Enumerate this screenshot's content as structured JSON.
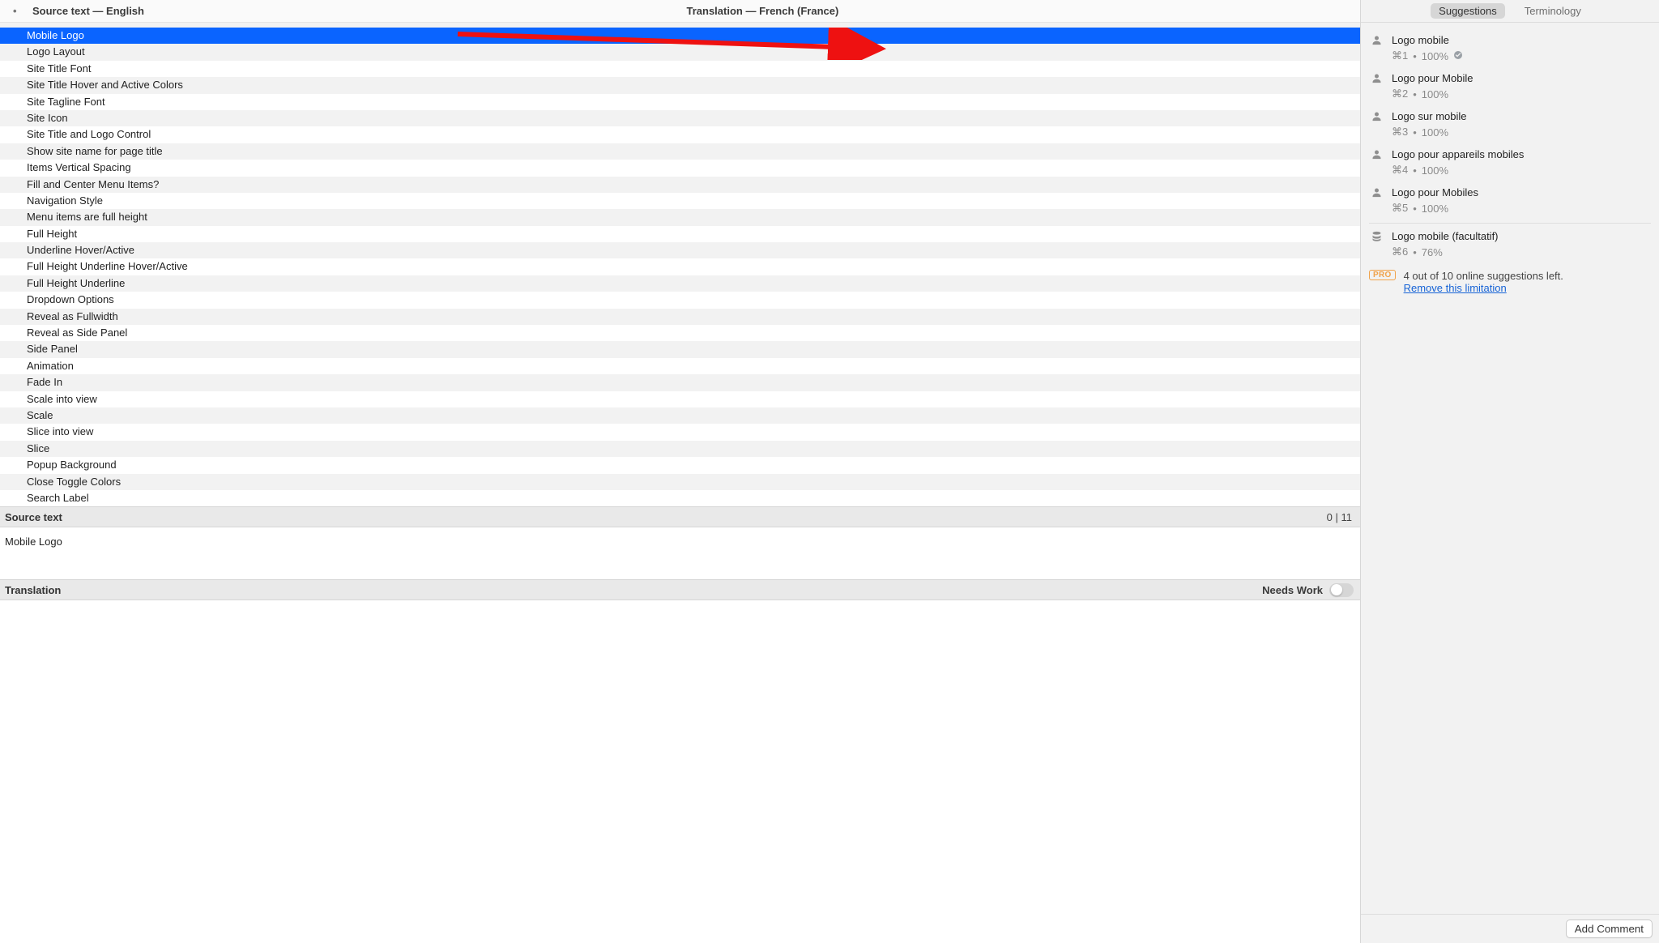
{
  "header": {
    "source_col": "Source text — English",
    "target_col": "Translation — French (France)"
  },
  "list": {
    "partial_top": "",
    "items": [
      "Mobile Logo",
      "Logo Layout",
      "Site Title Font",
      "Site Title Hover and Active Colors",
      "Site Tagline Font",
      "Site Icon",
      "Site Title and Logo Control",
      "Show site name for page title",
      "Items Vertical Spacing",
      "Fill and Center Menu Items?",
      "Navigation Style",
      "Menu items are full height",
      "Full Height",
      "Underline Hover/Active",
      "Full Height Underline Hover/Active",
      "Full Height Underline",
      "Dropdown Options",
      "Reveal as Fullwidth",
      "Reveal as Side Panel",
      "Side Panel",
      "Animation",
      "Fade In",
      "Scale into view",
      "Scale",
      "Slice into view",
      "Slice",
      "Popup Background",
      "Close Toggle Colors",
      "Search Label"
    ],
    "selected_index": 0
  },
  "source_pane": {
    "label": "Source text",
    "counts": "0 | 11",
    "value": "Mobile Logo"
  },
  "translation_pane": {
    "label": "Translation",
    "needs_work_label": "Needs Work",
    "value": ""
  },
  "right": {
    "tabs": {
      "suggestions": "Suggestions",
      "terminology": "Terminology",
      "active": "suggestions"
    },
    "suggestions": [
      {
        "icon": "person",
        "text": "Logo mobile",
        "shortcut": "⌘1",
        "match": "100%",
        "verified": true
      },
      {
        "icon": "person",
        "text": "Logo pour Mobile",
        "shortcut": "⌘2",
        "match": "100%",
        "verified": false
      },
      {
        "icon": "person",
        "text": "Logo sur mobile",
        "shortcut": "⌘3",
        "match": "100%",
        "verified": false
      },
      {
        "icon": "person",
        "text": "Logo pour appareils mobiles",
        "shortcut": "⌘4",
        "match": "100%",
        "verified": false
      },
      {
        "icon": "person",
        "text": "Logo pour Mobiles",
        "shortcut": "⌘5",
        "match": "100%",
        "verified": false
      }
    ],
    "extra_suggestions": [
      {
        "icon": "stack",
        "text": "Logo mobile (facultatif)",
        "shortcut": "⌘6",
        "match": "76%",
        "verified": false
      }
    ],
    "limitation": {
      "badge": "PRO",
      "text": "4 out of 10 online suggestions left.",
      "link": "Remove this limitation"
    },
    "add_comment": "Add Comment"
  }
}
